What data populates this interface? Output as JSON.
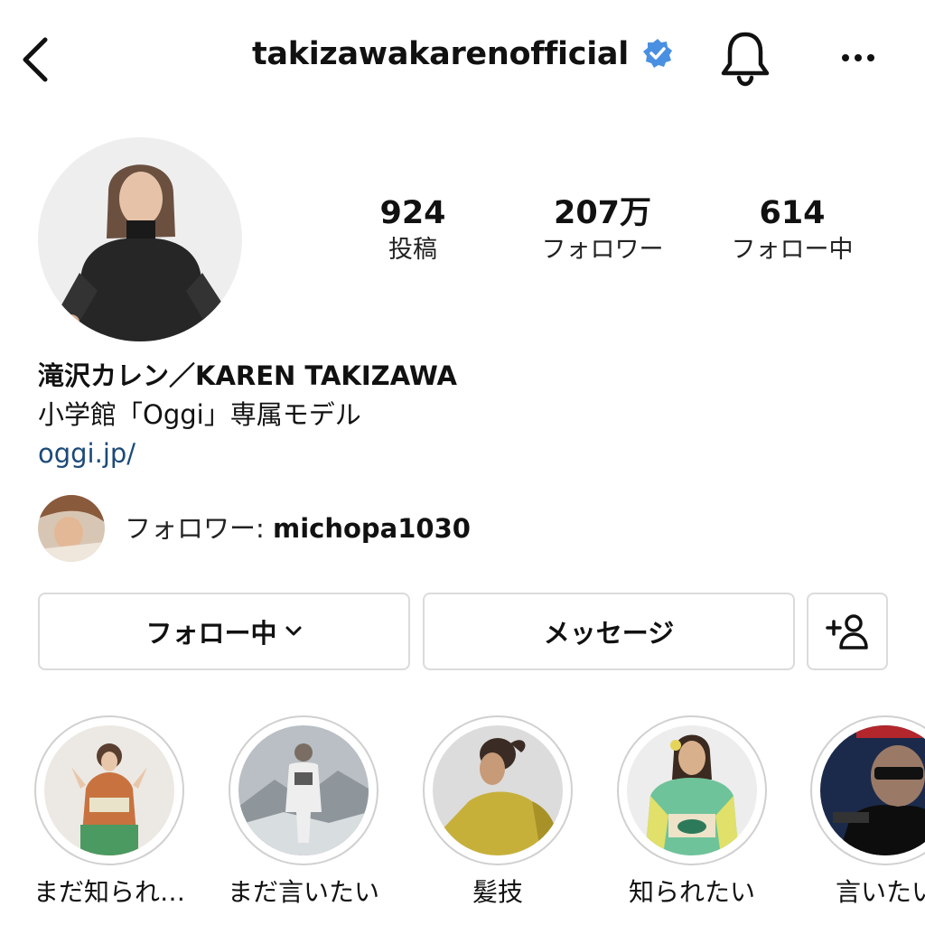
{
  "header": {
    "username": "takizawakarenofficial",
    "verified_icon": "verified-badge-icon",
    "accent": "#4a90e2"
  },
  "stats": [
    {
      "value": "924",
      "label": "投稿"
    },
    {
      "value": "207万",
      "label": "フォロワー"
    },
    {
      "value": "614",
      "label": "フォロー中"
    }
  ],
  "profile": {
    "name": "滝沢カレン／KAREN TAKIZAWA",
    "bio": "小学館「Oggi」専属モデル",
    "link": "oggi.jp/",
    "link_color": "#1b4a78"
  },
  "followed_by": {
    "prefix": "フォロワー: ",
    "user": "michopa1030"
  },
  "actions": {
    "following_label": "フォロー中",
    "message_label": "メッセージ",
    "add_person_icon": "add-person-icon"
  },
  "highlights": [
    {
      "label": "まだ知られ…"
    },
    {
      "label": "まだ言いたい"
    },
    {
      "label": "髪技"
    },
    {
      "label": "知られたい"
    },
    {
      "label": "言いたい"
    }
  ]
}
